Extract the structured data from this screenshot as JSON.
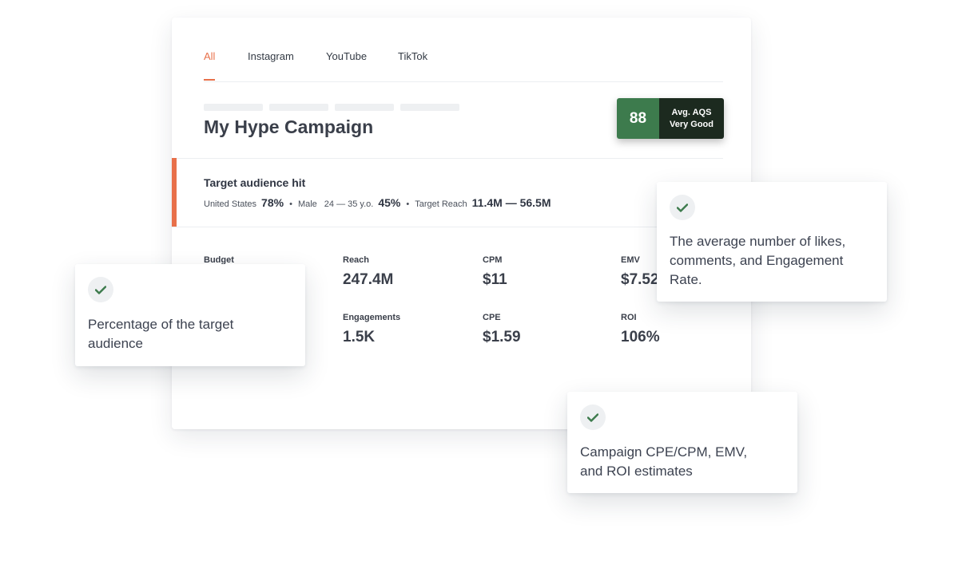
{
  "tabs": [
    {
      "label": "All",
      "active": true
    },
    {
      "label": "Instagram",
      "active": false
    },
    {
      "label": "YouTube",
      "active": false
    },
    {
      "label": "TikTok",
      "active": false
    }
  ],
  "campaign": {
    "title": "My Hype Campaign",
    "aqs": {
      "score": "88",
      "label_line1": "Avg. AQS",
      "label_line2": "Very Good"
    }
  },
  "audience": {
    "title": "Target audience hit",
    "country_label": "United States",
    "country_value": "78%",
    "gender_label": "Male",
    "age_label": "24 — 35 y.o.",
    "age_value": "45%",
    "reach_label": "Target Reach",
    "reach_value": "11.4M — 56.5M"
  },
  "metrics": [
    {
      "label": "Budget",
      "value": ""
    },
    {
      "label": "Reach",
      "value": "247.4M"
    },
    {
      "label": "CPM",
      "value": "$11"
    },
    {
      "label": "EMV",
      "value": "$7.52"
    },
    {
      "label": "Engagements",
      "value": "1.5K"
    },
    {
      "label": "CPE",
      "value": "$1.59"
    },
    {
      "label": "ROI",
      "value": "106%"
    }
  ],
  "tooltips": {
    "engagement": {
      "text_line1": "The average number of likes,",
      "text_line2": "comments, and Engagement",
      "text_line3": "Rate."
    },
    "audience": {
      "text_line1": "Percentage of the target",
      "text_line2": "audience"
    },
    "estimates": {
      "text_line1": "Campaign CPE/CPM, EMV,",
      "text_line2": "and ROI estimates"
    }
  },
  "colors": {
    "accent": "#e8704a",
    "aqs_green": "#3d7b4d",
    "aqs_dark": "#1c2a1f",
    "check": "#3d7b4d"
  }
}
